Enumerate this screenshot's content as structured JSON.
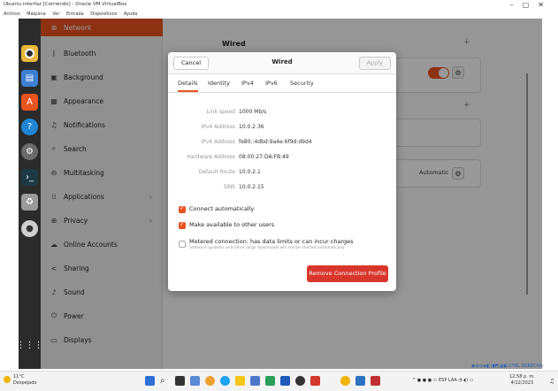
{
  "host": {
    "window_title": "Ubuntu interfaz [Corriendo] - Oracle VM VirtualBox",
    "window_controls": [
      "–",
      "▢",
      "✕"
    ],
    "menu": [
      "Archivo",
      "Máquina",
      "Ver",
      "Entrada",
      "Dispositivos",
      "Ayuda"
    ]
  },
  "sidebar": {
    "items": [
      {
        "label": "Network",
        "icon": "network-icon",
        "active": true
      },
      {
        "label": "Bluetooth",
        "icon": "bluetooth-icon"
      },
      {
        "label": "Background",
        "icon": "background-icon"
      },
      {
        "label": "Appearance",
        "icon": "appearance-icon"
      },
      {
        "label": "Notifications",
        "icon": "bell-icon"
      },
      {
        "label": "Search",
        "icon": "search-icon"
      },
      {
        "label": "Multitasking",
        "icon": "multitasking-icon"
      },
      {
        "label": "Applications",
        "icon": "applications-icon",
        "chevron": "›"
      },
      {
        "label": "Privacy",
        "icon": "privacy-icon",
        "chevron": "›"
      },
      {
        "label": "Online Accounts",
        "icon": "cloud-icon"
      },
      {
        "label": "Sharing",
        "icon": "share-icon"
      },
      {
        "label": "Sound",
        "icon": "music-icon"
      },
      {
        "label": "Power",
        "icon": "power-icon"
      },
      {
        "label": "Displays",
        "icon": "display-icon"
      }
    ]
  },
  "content": {
    "wired_title": "Wired",
    "plus": "+",
    "automatic_label": "Automatic"
  },
  "dialog": {
    "cancel": "Cancel",
    "title": "Wired",
    "apply": "Apply",
    "tabs": [
      "Details",
      "Identity",
      "IPv4",
      "IPv6",
      "Security"
    ],
    "details": [
      {
        "label": "Link speed",
        "value": "1000 Mb/s"
      },
      {
        "label": "IPv4 Address",
        "value": "10.0.2.36"
      },
      {
        "label": "IPv6 Address",
        "value": "fe80::4dbd:9a4e:6f9d:d9d4"
      },
      {
        "label": "Hardware Address",
        "value": "08:00:27:DA:FB:49"
      },
      {
        "label": "Default Route",
        "value": "10.0.2.1"
      },
      {
        "label": "DNS",
        "value": "10.0.2.15"
      }
    ],
    "connect_automatically": "Connect automatically",
    "make_available": "Make available to other users",
    "metered": "Metered connection: has data limits or can incur charges",
    "metered_sub": "Software updates and other large downloads will not be started automatically.",
    "remove_button": "Remove Connection Profile"
  },
  "host_status": {
    "ctrl_label": "CTRL DERECHA"
  },
  "taskbar": {
    "temperature": "11°C",
    "weather_text": "Despejado",
    "tray_lang": "ESP",
    "tray_lang2": "LAA",
    "time": "12:58 p. m.",
    "date": "4/12/2023"
  }
}
